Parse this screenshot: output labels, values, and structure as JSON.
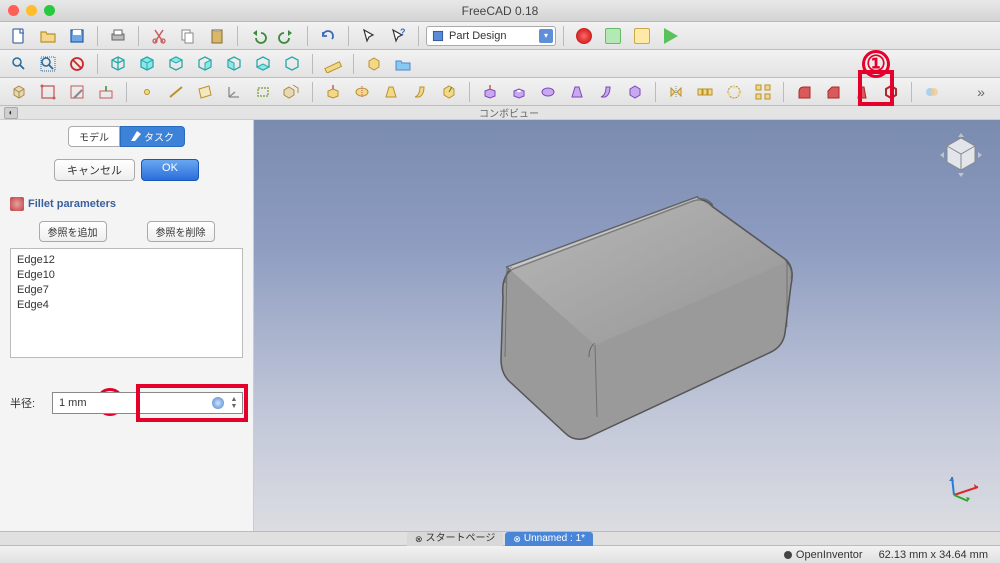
{
  "title": "FreeCAD 0.18",
  "workbench": "Part Design",
  "workbenchIcon": "partdesign-icon",
  "panel": {
    "title": "コンボビュー",
    "tabs": {
      "model": "モデル",
      "task": "タスク"
    },
    "cancel": "キャンセル",
    "ok": "OK",
    "section": "Fillet parameters",
    "addRef": "参照を追加",
    "removeRef": "参照を削除",
    "edges": [
      "Edge12",
      "Edge10",
      "Edge7",
      "Edge4"
    ],
    "radiusLabel": "半径:",
    "radiusValue": "1 mm"
  },
  "viewTabs": {
    "start": "スタートページ",
    "doc": "Unnamed : 1*"
  },
  "status": {
    "renderer": "OpenInventor",
    "coords": "62.13 mm x 34.64 mm"
  },
  "callouts": {
    "one": "①",
    "two": "②"
  }
}
